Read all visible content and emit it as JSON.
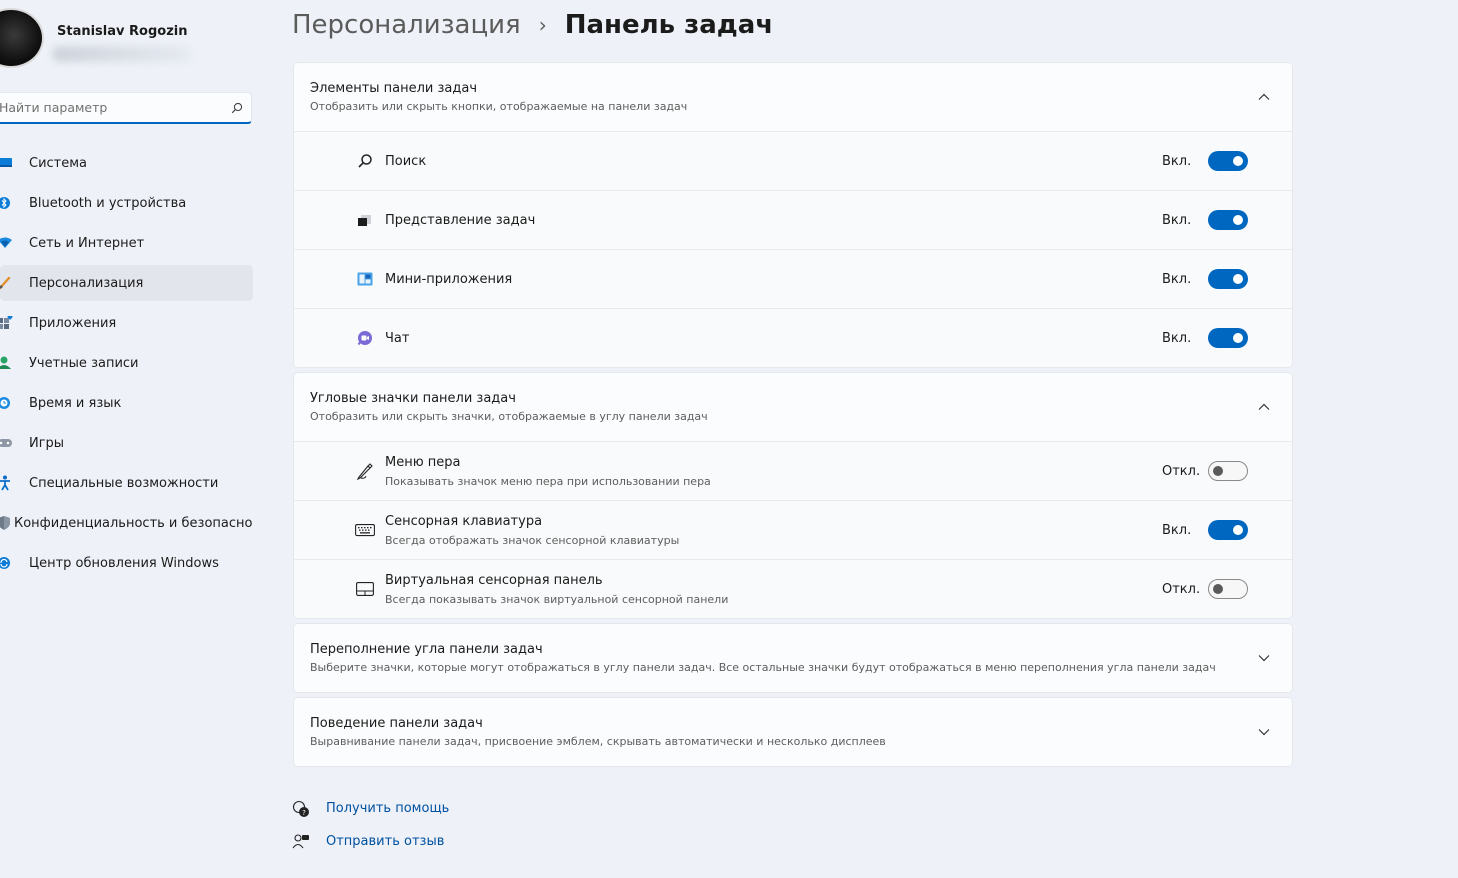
{
  "user": {
    "name": "Stanislav Rogozin"
  },
  "search": {
    "placeholder": "Найти параметр"
  },
  "sidebar": {
    "items": [
      {
        "label": "Система",
        "icon": "system-icon",
        "active": false
      },
      {
        "label": "Bluetooth и устройства",
        "icon": "bluetooth-icon",
        "active": false
      },
      {
        "label": "Сеть и Интернет",
        "icon": "network-icon",
        "active": false
      },
      {
        "label": "Персонализация",
        "icon": "brush-icon",
        "active": true
      },
      {
        "label": "Приложения",
        "icon": "apps-icon",
        "active": false
      },
      {
        "label": "Учетные записи",
        "icon": "accounts-icon",
        "active": false
      },
      {
        "label": "Время и язык",
        "icon": "time-language-icon",
        "active": false
      },
      {
        "label": "Игры",
        "icon": "gaming-icon",
        "active": false
      },
      {
        "label": "Специальные возможности",
        "icon": "accessibility-icon",
        "active": false
      },
      {
        "label": "Конфиденциальность и безопасность",
        "icon": "shield-icon",
        "active": false
      },
      {
        "label": "Центр обновления Windows",
        "icon": "update-icon",
        "active": false
      }
    ]
  },
  "breadcrumb": {
    "parent": "Персонализация",
    "separator": "›",
    "current": "Панель задач"
  },
  "groups": [
    {
      "title": "Элементы панели задач",
      "desc": "Отобразить или скрыть кнопки, отображаемые на панели задач",
      "expanded": true,
      "rows": [
        {
          "title": "Поиск",
          "state": "Вкл.",
          "on": true,
          "icon": "search-icon"
        },
        {
          "title": "Представление задач",
          "state": "Вкл.",
          "on": true,
          "icon": "task-view-icon"
        },
        {
          "title": "Мини-приложения",
          "state": "Вкл.",
          "on": true,
          "icon": "widgets-icon"
        },
        {
          "title": "Чат",
          "state": "Вкл.",
          "on": true,
          "icon": "chat-icon"
        }
      ]
    },
    {
      "title": "Угловые значки панели задач",
      "desc": "Отобразить или скрыть значки, отображаемые в углу панели задач",
      "expanded": true,
      "rows": [
        {
          "title": "Меню пера",
          "desc": "Показывать значок меню пера при использовании пера",
          "state": "Откл.",
          "on": false,
          "icon": "pen-icon"
        },
        {
          "title": "Сенсорная клавиатура",
          "desc": "Всегда отображать значок сенсорной клавиатуры",
          "state": "Вкл.",
          "on": true,
          "icon": "keyboard-icon"
        },
        {
          "title": "Виртуальная сенсорная панель",
          "desc": "Всегда показывать значок виртуальной сенсорной панели",
          "state": "Откл.",
          "on": false,
          "icon": "touchpad-icon"
        }
      ]
    },
    {
      "title": "Переполнение угла панели задач",
      "desc": "Выберите значки, которые могут отображаться в углу панели задач. Все остальные значки будут отображаться в меню переполнения угла панели задач",
      "expanded": false
    },
    {
      "title": "Поведение панели задач",
      "desc": "Выравнивание панели задач, присвоение эмблем, скрывать автоматически и несколько дисплеев",
      "expanded": false
    }
  ],
  "footer": {
    "help": "Получить помощь",
    "feedback": "Отправить отзыв"
  },
  "colors": {
    "accent": "#0067c0",
    "background": "#eef2f8",
    "card": "#fbfcfd"
  }
}
